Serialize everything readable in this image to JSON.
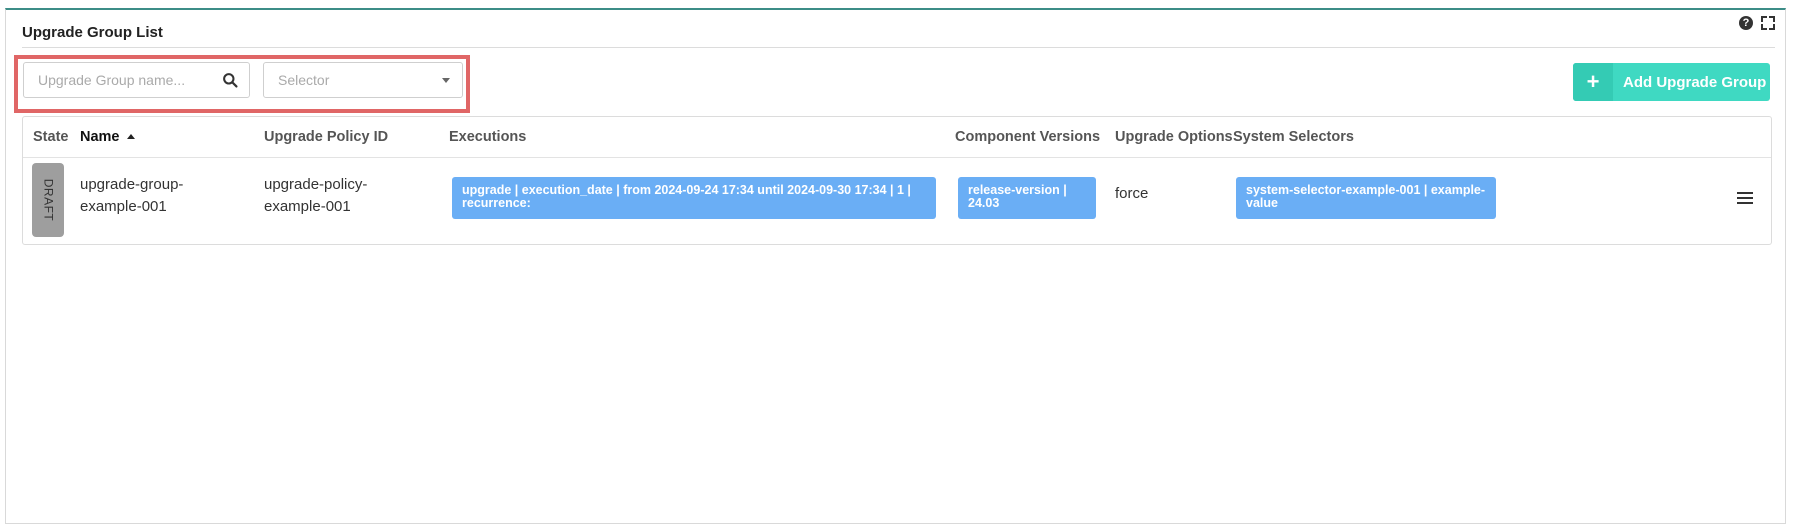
{
  "panel": {
    "title": "Upgrade Group List"
  },
  "tools": {
    "help_icon": "question-circle-icon",
    "expand_icon": "expand-icon"
  },
  "filters": {
    "search_placeholder": "Upgrade Group name...",
    "selector_placeholder": "Selector"
  },
  "actions": {
    "add_label": "Add Upgrade Group",
    "add_icon": "plus-icon"
  },
  "table": {
    "columns": [
      "State",
      "Name",
      "Upgrade Policy ID",
      "Executions",
      "Component Versions",
      "Upgrade Options",
      "System Selectors"
    ],
    "sorted_column": "Name",
    "sort_direction": "ascending",
    "rows": [
      {
        "state": "DRAFT",
        "name": "upgrade-group-example-001",
        "policy_id": "upgrade-policy-example-001",
        "execution": "upgrade | execution_date | from 2024-09-24 17:34 until 2024-09-30 17:34 | 1 | recurrence:",
        "component_version": "release-version | 24.03",
        "upgrade_options": "force",
        "system_selector": "system-selector-example-001 | example-value"
      }
    ]
  },
  "colors": {
    "accent_button": "#3fd9c2",
    "chip": "#6aaef5",
    "draft_badge": "#9e9e9e",
    "highlight_border": "#e06666"
  }
}
